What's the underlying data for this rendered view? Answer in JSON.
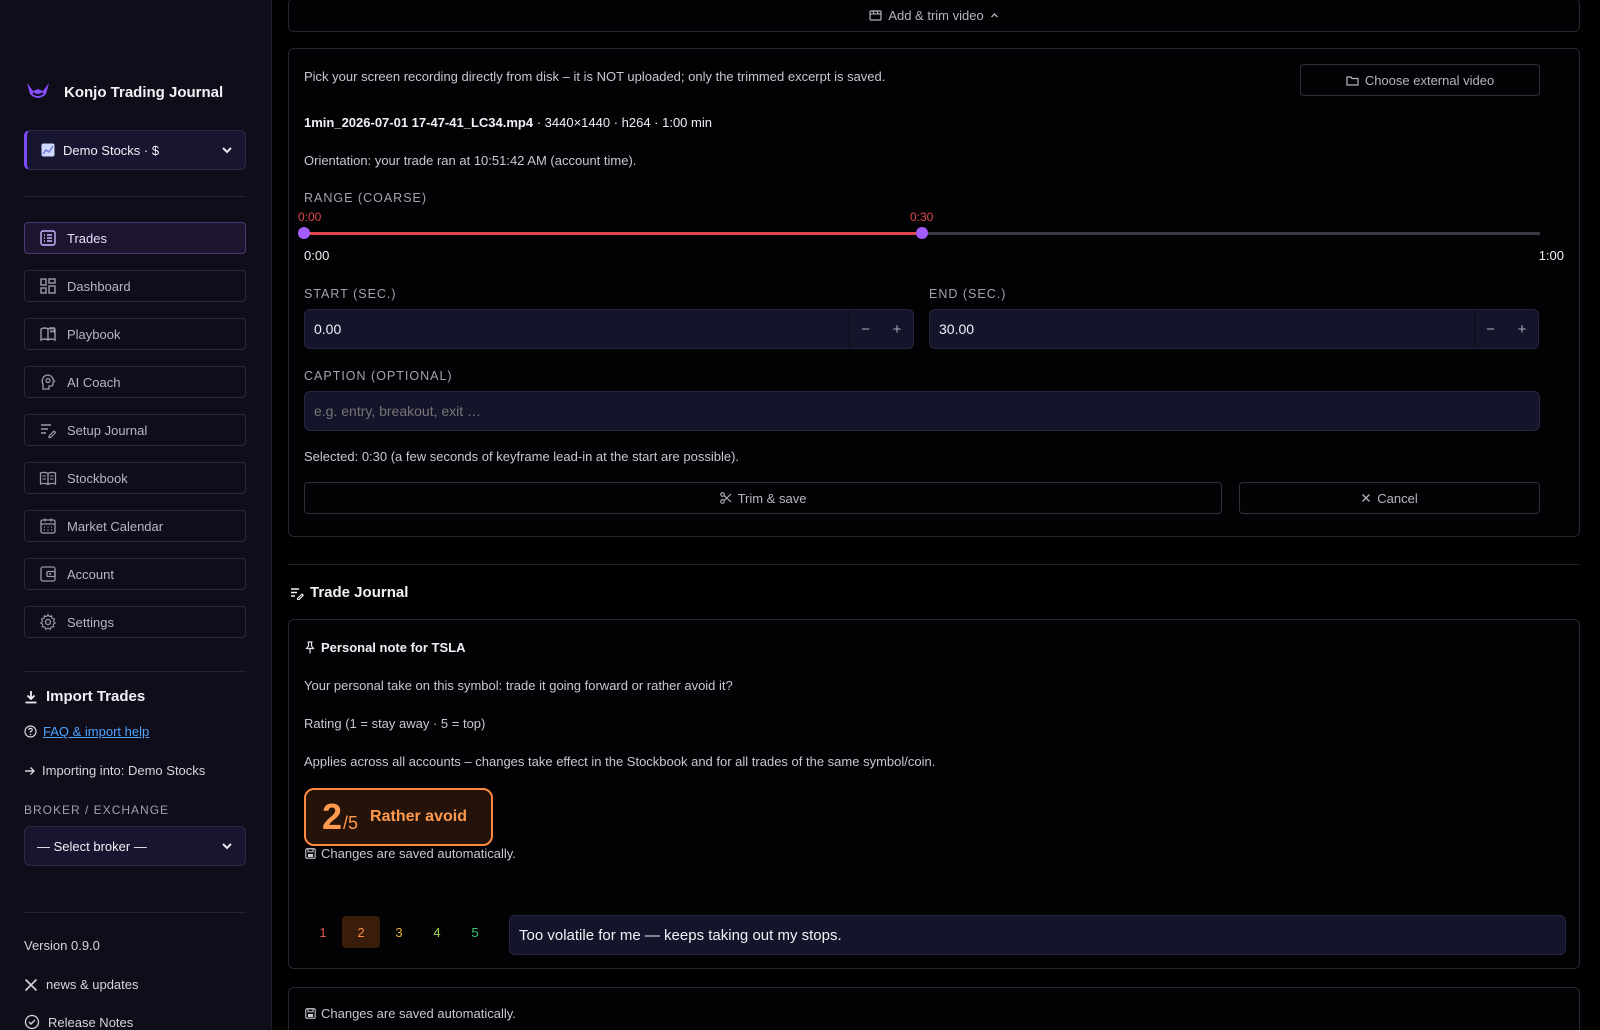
{
  "sidebar": {
    "brand": "Konjo Trading Journal",
    "account": "Demo Stocks · $",
    "nav": [
      {
        "label": "Trades",
        "icon": "list-icon",
        "active": true
      },
      {
        "label": "Dashboard",
        "icon": "dashboard-icon",
        "active": false
      },
      {
        "label": "Playbook",
        "icon": "book-open-icon",
        "active": false
      },
      {
        "label": "AI Coach",
        "icon": "brain-icon",
        "active": false
      },
      {
        "label": "Setup Journal",
        "icon": "edit-lines-icon",
        "active": false
      },
      {
        "label": "Stockbook",
        "icon": "book-icon",
        "active": false
      },
      {
        "label": "Market Calendar",
        "icon": "calendar-icon",
        "active": false
      },
      {
        "label": "Account",
        "icon": "wallet-icon",
        "active": false
      },
      {
        "label": "Settings",
        "icon": "gear-icon",
        "active": false
      }
    ],
    "import_title": "Import Trades",
    "faq_link": "FAQ & import help",
    "importing_into": "Importing into: Demo Stocks",
    "broker_label": "BROKER / EXCHANGE",
    "broker_select": "— Select broker —",
    "version": "Version 0.9.0",
    "news_link": "news & updates",
    "release_notes": "Release Notes"
  },
  "trim": {
    "toggle_label": "Add & trim video",
    "description": "Pick your screen recording directly from disk – it is NOT uploaded; only the trimmed excerpt is saved.",
    "choose_button": "Choose external video",
    "file_name": "1min_2026-07-01 17-47-41_LC34.mp4",
    "file_meta": " · 3440×1440 · h264 · 1:00 min",
    "orientation": "Orientation: your trade ran at 10:51:42 AM (account time).",
    "range_label": "RANGE (COARSE)",
    "range": {
      "start_label": "0:00",
      "end_label": "0:30",
      "min_label": "0:00",
      "max_label": "1:00",
      "start": 0,
      "end": 30,
      "max": 60
    },
    "start_label": "START (SEC.)",
    "start_value": "0.00",
    "end_label": "END (SEC.)",
    "end_value": "30.00",
    "caption_label": "CAPTION (OPTIONAL)",
    "caption_placeholder": "e.g. entry, breakout, exit …",
    "selected_text": "Selected: 0:30 (a few seconds of keyframe lead-in at the start are possible).",
    "trim_button": "Trim & save",
    "cancel_button": "Cancel",
    "minus": "−",
    "plus": "+"
  },
  "journal": {
    "title": "Trade Journal",
    "note_title": "Personal note for TSLA",
    "question": "Your personal take on this symbol: trade it going forward or rather avoid it?",
    "rating_scale": "Rating (1 = stay away · 5 = top)",
    "applies": "Applies across all accounts – changes take effect in the Stockbook and for all trades of the same symbol/coin.",
    "rating": 2,
    "rating_value": "2",
    "rating_max": "/5",
    "rating_text": "Rather avoid",
    "autosave": "Changes are saved automatically.",
    "rating_options": [
      "1",
      "2",
      "3",
      "4",
      "5"
    ],
    "rating_colors": [
      "#e0574f",
      "#ff8a3d",
      "#e6b53a",
      "#9bd34a",
      "#3ec46d"
    ],
    "note_text": "Too volatile for me — keeps taking out my stops.",
    "bottom_autosave": "Changes are saved automatically."
  },
  "colors": {
    "accent": "#a35dff",
    "range_fill": "#e0484d",
    "rating_accent": "#ff8a3d"
  }
}
